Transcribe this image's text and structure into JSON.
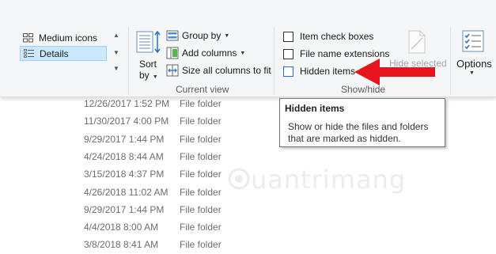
{
  "layout": {
    "items": [
      {
        "label": "Medium icons",
        "selected": false
      },
      {
        "label": "Details",
        "selected": true
      }
    ]
  },
  "current_view": {
    "sort_label_line1": "Sort",
    "sort_label_line2": "by",
    "group_by_label": "Group by",
    "add_columns_label": "Add columns",
    "size_columns_label": "Size all columns to fit",
    "group_label": "Current view"
  },
  "show_hide": {
    "item_check_boxes_label": "Item check boxes",
    "file_name_extensions_label": "File name extensions",
    "hidden_items_label": "Hidden items",
    "hide_selected_label": "Hide selected",
    "group_label": "Show/hide"
  },
  "options": {
    "label": "Options"
  },
  "tooltip": {
    "title": "Hidden items",
    "body": "Show or hide the files and folders that are marked as hidden."
  },
  "file_rows": [
    {
      "date": "12/26/2017 1:52 PM",
      "type": "File folder"
    },
    {
      "date": "11/30/2017 4:00 PM",
      "type": "File folder"
    },
    {
      "date": "9/29/2017 1:44 PM",
      "type": "File folder"
    },
    {
      "date": "4/24/2018 8:44 AM",
      "type": "File folder"
    },
    {
      "date": "3/15/2018 4:37 PM",
      "type": "File folder"
    },
    {
      "date": "4/26/2018 11:02 AM",
      "type": "File folder"
    },
    {
      "date": "9/29/2017 1:44 PM",
      "type": "File folder"
    },
    {
      "date": "4/4/2018 8:00 AM",
      "type": "File folder"
    },
    {
      "date": "3/8/2018 8:41 AM",
      "type": "File folder"
    }
  ],
  "watermark": {
    "text": "uantrimang"
  },
  "colors": {
    "selection_bg": "#cce8ff",
    "arrow_red": "#e8141b",
    "ribbon_bg": "#f5f6f7"
  }
}
